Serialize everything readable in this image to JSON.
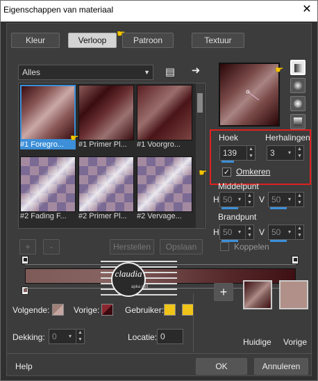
{
  "window": {
    "title": "Eigenschappen van materiaal",
    "close": "✕"
  },
  "tabs": [
    {
      "label": "Kleur"
    },
    {
      "label": "Verloop"
    },
    {
      "label": "Patroon"
    },
    {
      "label": "Textuur"
    }
  ],
  "gradient_list": {
    "category": "Alles",
    "items": [
      {
        "label": "#1 Foregro..."
      },
      {
        "label": "#1 Primer Pl..."
      },
      {
        "label": "#1 Voorgro..."
      },
      {
        "label": "#2 Fading F..."
      },
      {
        "label": "#2 Primer Pl..."
      },
      {
        "label": "#2 Vervage..."
      }
    ]
  },
  "small_buttons": {
    "add": "+",
    "remove": "-",
    "restore": "Herstellen",
    "save": "Opslaan"
  },
  "angle": {
    "label": "Hoek",
    "value": "139"
  },
  "repeats": {
    "label": "Herhalingen",
    "value": "3"
  },
  "invert": {
    "label": "Omkeren",
    "checked": "✓"
  },
  "midpoint": {
    "label": "Middelpunt",
    "h_label": "H",
    "h_value": "50",
    "v_label": "V",
    "v_value": "50"
  },
  "focal": {
    "label": "Brandpunt",
    "h_label": "H",
    "h_value": "50",
    "v_label": "V",
    "v_value": "50",
    "link_label": "Koppelen"
  },
  "stops": {
    "next_label": "Volgende:",
    "prev_label": "Vorige:",
    "user_label": "Gebruiker:",
    "opacity_label": "Dekking:",
    "opacity_value": "0",
    "location_label": "Locatie:",
    "location_value": "0"
  },
  "current": {
    "label": "Huidige",
    "plus": "+"
  },
  "previous": {
    "label": "Vorige"
  },
  "footer": {
    "help": "Help",
    "ok": "OK",
    "cancel": "Annuleren"
  },
  "watermark": {
    "text": "claudia",
    "sub": "apka dell"
  },
  "colors": {
    "accent": "#3c8fd8",
    "highlight": "#e0201e",
    "foreground": "#7e5b58",
    "background": "#3e1014",
    "user": "#f0c419"
  }
}
